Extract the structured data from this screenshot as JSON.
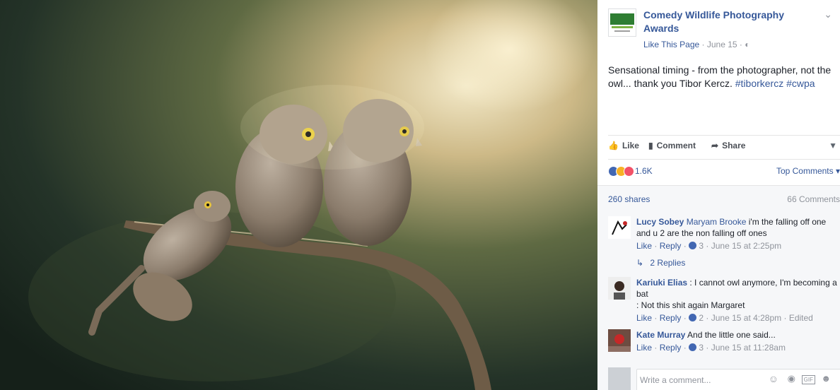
{
  "post": {
    "page_name": "Comedy Wildlife Photography Awards",
    "logo_text": "The Comedy Wildlife",
    "like_page": "Like This Page",
    "date": "June 15",
    "text": "Sensational timing - from the photographer, not the owl... thank you Tibor Kercz.",
    "hashtags": [
      "#tiborkercz",
      "#cwpa"
    ]
  },
  "actions": {
    "like": "Like",
    "comment": "Comment",
    "share": "Share"
  },
  "reactions": {
    "count": "1.6K",
    "sort": "Top Comments"
  },
  "stats": {
    "shares": "260 shares",
    "comments": "66 Comments"
  },
  "comments": [
    {
      "author": "Lucy Sobey",
      "tag": "Maryam Brooke",
      "text": "i'm the falling off one and u 2 are the non falling off ones",
      "like": "Like",
      "reply": "Reply",
      "likes": "3",
      "time": "June 15 at 2:25pm",
      "replies": "2 Replies"
    },
    {
      "author": "Kariuki Elias",
      "text": ": I cannot owl anymore, I'm becoming a bat",
      "text2": ": Not this shit again Margaret",
      "like": "Like",
      "reply": "Reply",
      "likes": "2",
      "time": "June 15 at 4:28pm",
      "edited": "Edited"
    },
    {
      "author": "Kate Murray",
      "text": "And the little one said...",
      "like": "Like",
      "reply": "Reply",
      "likes": "3",
      "time": "June 15 at 11:28am"
    }
  ],
  "write": {
    "placeholder": "Write a comment..."
  },
  "colors": {
    "link": "#365899",
    "muted": "#90949c",
    "fb_blue": "#4267b2",
    "love": "#f25268"
  }
}
